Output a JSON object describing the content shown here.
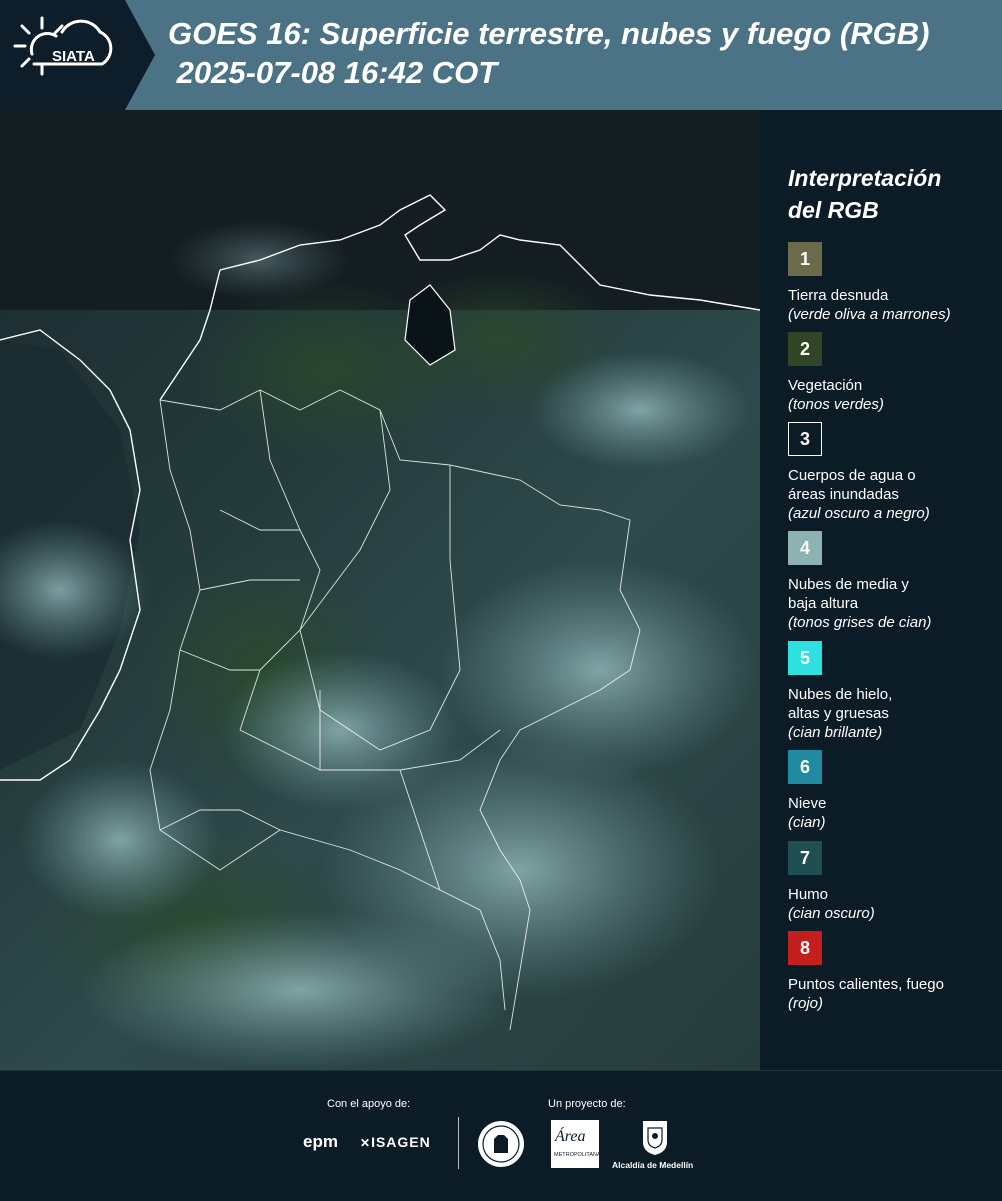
{
  "header": {
    "logo_text": "SIATA",
    "title_line1": "GOES 16: Superficie terrestre, nubes y fuego (RGB)",
    "title_line2": " 2025-07-08 16:42 COT"
  },
  "legend": {
    "title": "Interpretación\ndel RGB",
    "items": [
      {
        "num": "1",
        "label": "Tierra desnuda",
        "note": "(verde oliva a marrones)",
        "color": "#6b6a4a"
      },
      {
        "num": "2",
        "label": "Vegetación",
        "note": "(tonos verdes)",
        "color": "#2f4526"
      },
      {
        "num": "3",
        "label": "Cuerpos de agua o\náreas inundadas",
        "note": "(azul oscuro a negro)",
        "color": "#0c1c27"
      },
      {
        "num": "4",
        "label": "Nubes de media y\nbaja altura",
        "note": "(tonos grises de cian)",
        "color": "#8cb2b2"
      },
      {
        "num": "5",
        "label": "Nubes de hielo,\naltas y gruesas",
        "note": "(cian brillante)",
        "color": "#2ee0e0"
      },
      {
        "num": "6",
        "label": "Nieve",
        "note": "(cian)",
        "color": "#1f8aa0"
      },
      {
        "num": "7",
        "label": "Humo",
        "note": "(cian oscuro)",
        "color": "#1f4f52"
      },
      {
        "num": "8",
        "label": "Puntos calientes, fuego",
        "note": "(rojo)",
        "color": "#c41e1e"
      }
    ]
  },
  "footer": {
    "support_label": "Con el apoyo de:",
    "project_label": "Un proyecto de:",
    "epm": "epm",
    "isagen": "ISAGEN",
    "area_text": "Área",
    "area_sub": "METROPOLITANA",
    "alcaldia": "Alcaldía de Medellín"
  },
  "map": {
    "description_icon": "satellite-map-image"
  }
}
